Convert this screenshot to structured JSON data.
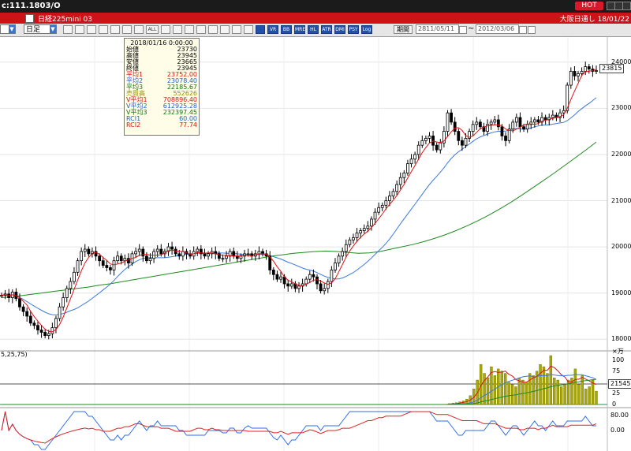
{
  "window": {
    "title": "c:111.1803/O",
    "hot_label": "HOT"
  },
  "infobar": {
    "symbol": "日経225mini 03",
    "right_text": "大阪日通し  18/01/22"
  },
  "toolbar": {
    "period_select": "日足",
    "buttons": [
      "zoom-in",
      "zoom-out",
      "candle",
      "grid",
      "measure",
      "cross",
      "crosshair",
      "all",
      "eye",
      "trend",
      "move",
      "draw",
      "pencil",
      "color",
      "eraser",
      "sma",
      "bollinger",
      "ichimoku",
      "rsi",
      "macd",
      "stochastic",
      "atr",
      "dmi",
      "psy",
      "log"
    ],
    "all_label": "ALL",
    "indicator_labels": [
      "VR",
      "BB",
      "MRE",
      "HL",
      "ATR",
      "DMI",
      "PSY"
    ],
    "log_label": "Log",
    "period_button": "期間",
    "from_date": "2811/05/11",
    "to_date": "2012/03/06"
  },
  "databox": {
    "datetime": "2018/01/16 0:00:00",
    "rows": [
      {
        "label": "始値",
        "value": "23730",
        "color": "#000000"
      },
      {
        "label": "高値",
        "value": "23945",
        "color": "#000000"
      },
      {
        "label": "安値",
        "value": "23665",
        "color": "#000000"
      },
      {
        "label": "終値",
        "value": "23945",
        "color": "#000000"
      },
      {
        "label": "平均1",
        "value": "23752.00",
        "color": "#e01010"
      },
      {
        "label": "平均2",
        "value": "23078.40",
        "color": "#2060d0"
      },
      {
        "label": "平均3",
        "value": "22185.67",
        "color": "#107010"
      },
      {
        "label": "売買高",
        "value": "552626",
        "color": "#909000"
      },
      {
        "label": "V平均1",
        "value": "708896.40",
        "color": "#e01010"
      },
      {
        "label": "V平均2",
        "value": "612925.28",
        "color": "#2060d0"
      },
      {
        "label": "V平均3",
        "value": "232397.45",
        "color": "#107010"
      },
      {
        "label": "RCI1",
        "value": "60.00",
        "color": "#2060d0"
      },
      {
        "label": "RCI2",
        "value": "77.74",
        "color": "#e01010"
      }
    ]
  },
  "price_axis": {
    "ticks": [
      "24000",
      "23000",
      "22000",
      "21000",
      "20000",
      "19000",
      "18000"
    ],
    "current": "23815"
  },
  "volume_axis": {
    "unit": "×万",
    "ticks": [
      "100",
      "75",
      "50",
      "25",
      "0"
    ],
    "current": "21545"
  },
  "rci_axis": {
    "ticks": [
      "80.00",
      "0.00"
    ],
    "label_left": "5,25,75)"
  },
  "colors": {
    "ma1": "#e01010",
    "ma2": "#3a78e0",
    "ma3": "#1e8a1e",
    "volume": "#a8a800",
    "rci1": "#2a6ee8",
    "rci2": "#e02020"
  },
  "chart_data": {
    "type": "candlestick",
    "ylim": [
      17800,
      24200
    ],
    "tick_values": [
      24000,
      23000,
      22000,
      21000,
      20000,
      19000,
      18000
    ],
    "closes": [
      18950,
      18980,
      18900,
      19020,
      18880,
      18700,
      18600,
      18500,
      18350,
      18300,
      18200,
      18150,
      18080,
      18120,
      18250,
      18450,
      18700,
      18900,
      19100,
      19250,
      19450,
      19700,
      19900,
      19950,
      19850,
      19900,
      19800,
      19700,
      19600,
      19550,
      19500,
      19700,
      19800,
      19700,
      19750,
      19650,
      19850,
      19900,
      19950,
      19800,
      19700,
      19750,
      19900,
      19950,
      19850,
      19900,
      20000,
      19950,
      19850,
      19800,
      19900,
      19850,
      19800,
      19900,
      19950,
      19850,
      19800,
      19850,
      19900,
      19850,
      19750,
      19750,
      19800,
      19900,
      19800,
      19750,
      19800,
      19850,
      19850,
      19800,
      19850,
      19900,
      19850,
      19800,
      19500,
      19400,
      19300,
      19350,
      19200,
      19150,
      19200,
      19100,
      19150,
      19200,
      19300,
      19400,
      19350,
      19200,
      19050,
      19100,
      19250,
      19500,
      19650,
      19800,
      19900,
      20050,
      20150,
      20200,
      20300,
      20350,
      20400,
      20450,
      20600,
      20750,
      20850,
      20900,
      21000,
      21100,
      21200,
      21350,
      21500,
      21600,
      21800,
      21900,
      22000,
      22200,
      22300,
      22350,
      22400,
      22200,
      22100,
      22250,
      22500,
      22900,
      22700,
      22500,
      22300,
      22200,
      22350,
      22500,
      22650,
      22700,
      22600,
      22500,
      22650,
      22700,
      22750,
      22600,
      22400,
      22300,
      22550,
      22700,
      22800,
      22600,
      22550,
      22650,
      22700,
      22750,
      22700,
      22800,
      22750,
      22800,
      22850,
      22800,
      22900,
      22950,
      23500,
      23800,
      23700,
      23750,
      23800,
      23900,
      23850,
      23800,
      23815
    ],
    "ma3": [
      18900,
      18920,
      18950,
      18980,
      19010,
      19040,
      19070,
      19100,
      19130,
      19170,
      19200,
      19240,
      19280,
      19320,
      19360,
      19400,
      19440,
      19480,
      19520,
      19560,
      19600,
      19640,
      19680,
      19720,
      19760,
      19800,
      19830,
      19860,
      19880,
      19900,
      19910,
      19900,
      19880,
      19860,
      19870,
      19900,
      19950,
      20000,
      20050,
      20110,
      20180,
      20260,
      20350,
      20450,
      20560,
      20680,
      20810,
      20950,
      21100,
      21260,
      21420,
      21580,
      21750,
      21920,
      22090,
      22270
    ],
    "volume": [
      0,
      0,
      0,
      0,
      0,
      0,
      0,
      0,
      0,
      0,
      0,
      0,
      0,
      0,
      0,
      0,
      0,
      0,
      0,
      0,
      0,
      0,
      0,
      0,
      0,
      0,
      0,
      0,
      0,
      0,
      0,
      0,
      0,
      0,
      0,
      0,
      0,
      0,
      0,
      0,
      0,
      0,
      0,
      0,
      0,
      0,
      0,
      0,
      0,
      0,
      0,
      0,
      0,
      0,
      0,
      0,
      0,
      0,
      0,
      0,
      0,
      0,
      0,
      0,
      0,
      0,
      0,
      0,
      0,
      0,
      0,
      0,
      0,
      0,
      0,
      0,
      0,
      0,
      0,
      0,
      0,
      0,
      0,
      0,
      0,
      0,
      0,
      0,
      0,
      0,
      0,
      0,
      0,
      0,
      0,
      0,
      0,
      0,
      0,
      0,
      0,
      0,
      0,
      0,
      0,
      0,
      0,
      0,
      0,
      0,
      0,
      0,
      0,
      0,
      0,
      0,
      0,
      0,
      0,
      0,
      0,
      0,
      0,
      0,
      0,
      0,
      0,
      0,
      2,
      3,
      4,
      6,
      8,
      12,
      20,
      35,
      55,
      90,
      70,
      60,
      85,
      65,
      80,
      75,
      70,
      50,
      45,
      40,
      60,
      55,
      50,
      70,
      65,
      75,
      90,
      85,
      70,
      110,
      60,
      55,
      40,
      45,
      55,
      60,
      80,
      45,
      65,
      35,
      40,
      55,
      30
    ]
  }
}
